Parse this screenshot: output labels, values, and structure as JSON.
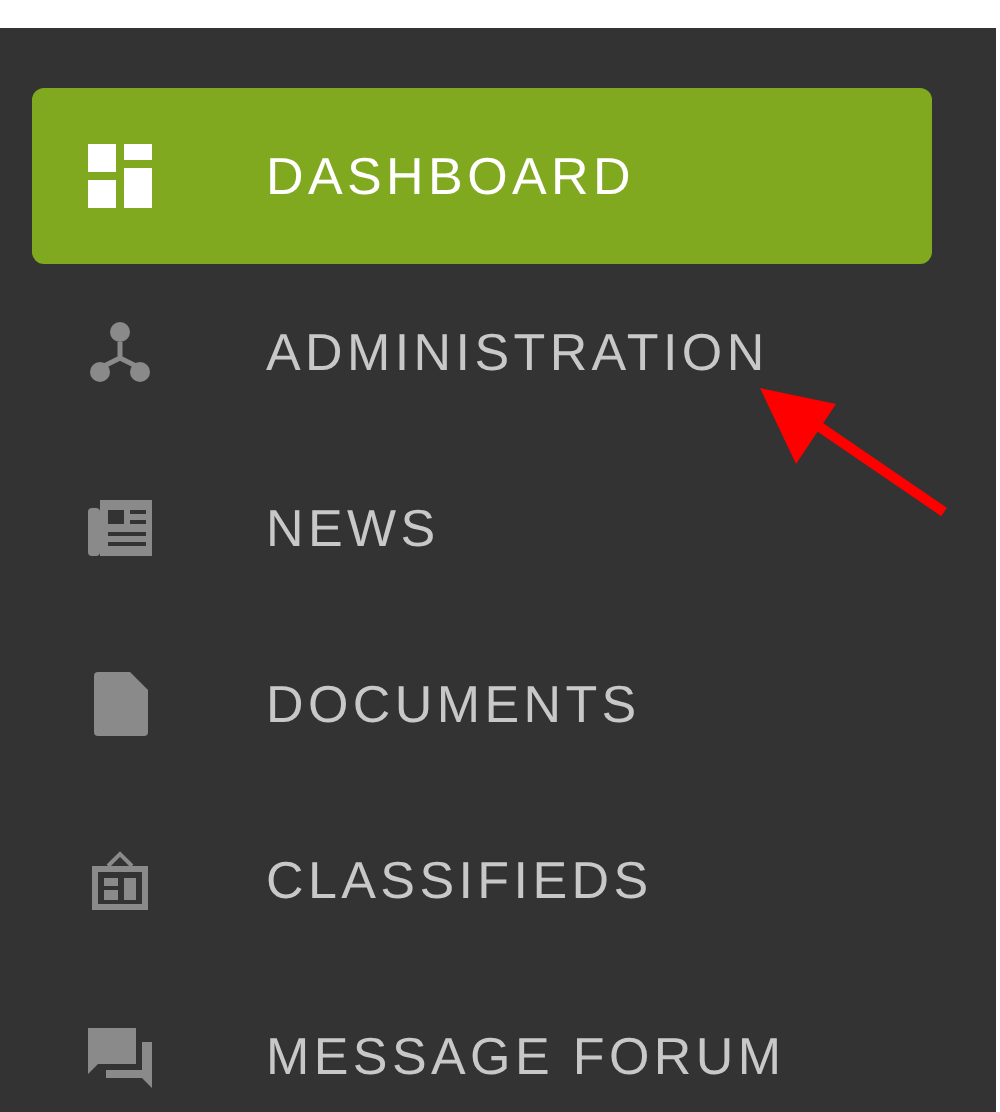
{
  "sidebar": {
    "items": [
      {
        "label": "DASHBOARD",
        "selected": true
      },
      {
        "label": "ADMINISTRATION",
        "selected": false
      },
      {
        "label": "NEWS",
        "selected": false
      },
      {
        "label": "DOCUMENTS",
        "selected": false
      },
      {
        "label": "CLASSIFIEDS",
        "selected": false
      },
      {
        "label": "MESSAGE FORUM",
        "selected": false
      }
    ]
  }
}
